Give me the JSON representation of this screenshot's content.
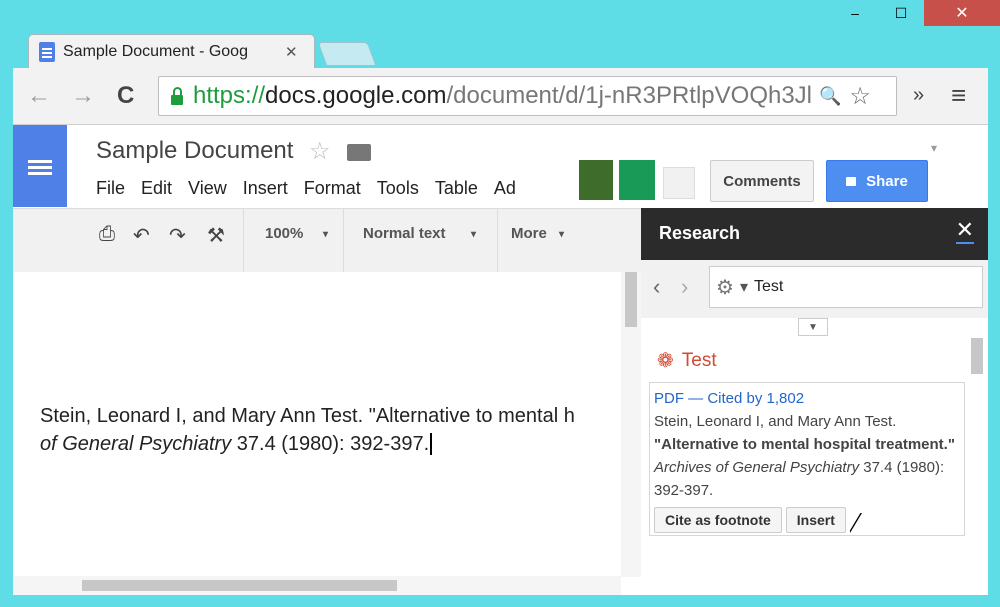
{
  "window": {
    "min": "–",
    "max": "☐",
    "close": "✕"
  },
  "tab": {
    "title": "Sample Document - Goog",
    "close": "✕"
  },
  "toolbar": {
    "back": "←",
    "forward": "→",
    "reload": "C",
    "url_https": "https://",
    "url_host": "docs.google.com",
    "url_path": "/document/d/1j-nR3PRtlpVOQh3Jl",
    "zoom_icon": "🔍",
    "star_icon": "☆",
    "extensions": "»",
    "menu": "≡"
  },
  "docs": {
    "title": "Sample Document",
    "menu": [
      "File",
      "Edit",
      "View",
      "Insert",
      "Format",
      "Tools",
      "Table",
      "Ad"
    ],
    "comments_label": "Comments",
    "share_label": "Share",
    "zoom": "100%",
    "style": "Normal text",
    "more": "More"
  },
  "document": {
    "line1_a": "Stein, Leonard I, and Mary Ann Test. \"Alternative to mental h",
    "line2_italic": "of General Psychiatry",
    "line2_rest": " 37.4 (1980): 392-397."
  },
  "research": {
    "title": "Research",
    "close": "✕",
    "search_query": "Test",
    "result_heading": "Test",
    "links": "PDF — Cited by 1,802",
    "authors": "Stein, Leonard I, and Mary Ann Test.",
    "title_bold": "\"Alternative to mental hospital treatment.\"",
    "journal_italic": "Archives of General Psychiatry",
    "pages": " 37.4 (1980): 392-397.",
    "cite_label": "Cite as footnote",
    "insert_label": "Insert"
  },
  "colors": {
    "accent": "#4d8ef0",
    "docs_blue": "#4f80e7",
    "research_red": "#d04b34",
    "window_bg": "#5fdde6"
  }
}
